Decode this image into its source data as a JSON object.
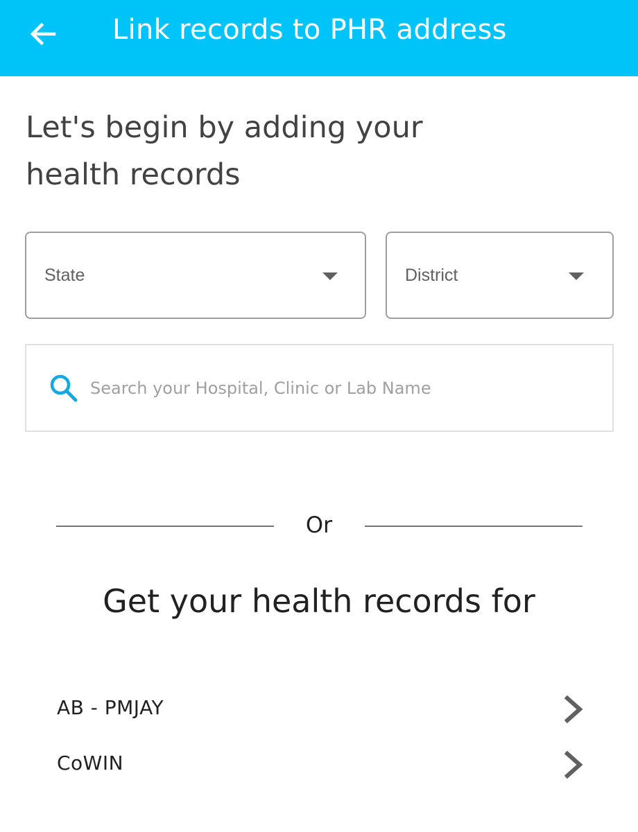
{
  "header": {
    "title": "Link records to PHR address",
    "back_icon": "arrow-left-icon",
    "background_color": "#00c3f7"
  },
  "intro": {
    "heading_line1": "Let's begin by adding your",
    "heading_line2": "health records"
  },
  "filters": {
    "state_label": "State",
    "district_label": "District"
  },
  "search": {
    "placeholder": "Search your Hospital, Clinic or Lab Name",
    "value": "",
    "icon": "search-icon",
    "icon_color": "#17a8e3"
  },
  "divider": {
    "text": "Or"
  },
  "records": {
    "heading": "Get your health records for",
    "items": [
      {
        "label": "AB - PMJAY",
        "icon": "chevron-right-icon"
      },
      {
        "label": "CoWIN",
        "icon": "chevron-right-icon"
      }
    ]
  }
}
